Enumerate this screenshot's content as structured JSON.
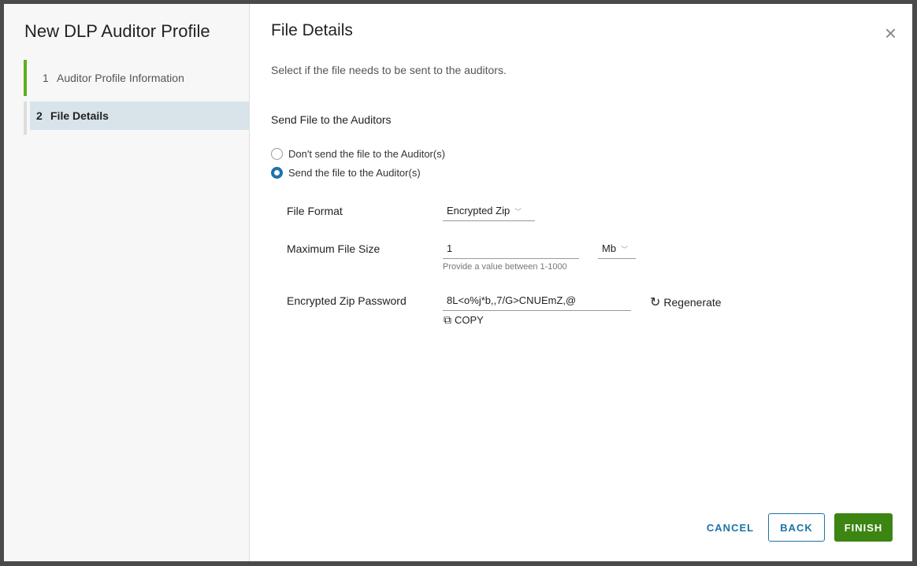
{
  "sidebar": {
    "title": "New DLP Auditor Profile",
    "steps": [
      {
        "num": "1",
        "label": "Auditor Profile Information"
      },
      {
        "num": "2",
        "label": "File Details"
      }
    ]
  },
  "main": {
    "title": "File Details",
    "description": "Select if the file needs to be sent to the auditors.",
    "section": "Send File to the Auditors",
    "radio_options": [
      "Don't send the file to the Auditor(s)",
      "Send the file to the Auditor(s)"
    ],
    "file_format": {
      "label": "File Format",
      "value": "Encrypted Zip"
    },
    "max_size": {
      "label": "Maximum File Size",
      "value": "1",
      "unit": "Mb",
      "help": "Provide a value between 1-1000"
    },
    "password": {
      "label": "Encrypted Zip Password",
      "value": "8L<o%j*b,,7/G>CNUEmZ,@",
      "regenerate": "Regenerate",
      "copy": "COPY"
    }
  },
  "footer": {
    "cancel": "CANCEL",
    "back": "BACK",
    "finish": "FINISH"
  },
  "colors": {
    "accent": "#1e73a8",
    "finish": "#3c8512",
    "step_done": "#5cb021"
  }
}
